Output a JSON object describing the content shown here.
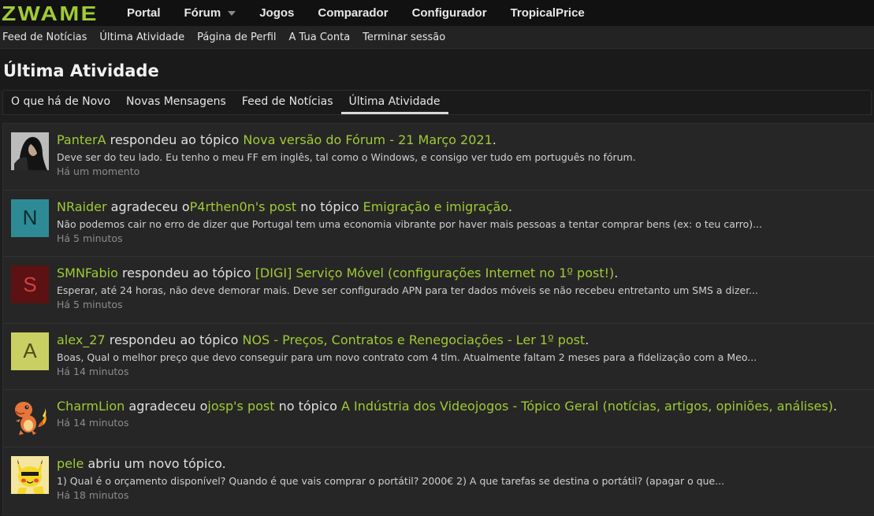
{
  "logo": "ZWAME",
  "topnav": [
    "Portal",
    "Fórum",
    "Jogos",
    "Comparador",
    "Configurador",
    "TropicalPrice"
  ],
  "subnav": [
    "Feed de Notícias",
    "Última Atividade",
    "Página de Perfil",
    "A Tua Conta",
    "Terminar sessão"
  ],
  "page_title": "Última Atividade",
  "tabs": [
    "O que há de Novo",
    "Novas Mensagens",
    "Feed de Notícias",
    "Última Atividade"
  ],
  "colors": {
    "accent": "#9fcb34",
    "background": "#1e1e1e",
    "panel": "#262626"
  },
  "items": [
    {
      "user": "PanterA",
      "verb": " respondeu ao tópico ",
      "thread": "Nova versão do Fórum - 21 Março 2021",
      "end": ".",
      "snippet": "Deve ser do teu lado. Eu tenho o meu FF em inglês, tal como o Windows, e consigo ver tudo em português no fórum.",
      "time": "Há um momento",
      "avatar": {
        "type": "photo",
        "letter": ""
      }
    },
    {
      "user": "NRaider",
      "verb": " agradeceu o",
      "post_owner": "P4rthen0n's post",
      "verb2": " no tópico ",
      "thread": "Emigração e imigração",
      "end": ".",
      "snippet": "Não podemos cair no erro de dizer que Portugal tem uma economia vibrante por haver mais pessoas a tentar comprar bens (ex: o teu carro)...",
      "time": "Há 5 minutos",
      "avatar": {
        "type": "letter",
        "letter": "N",
        "bg": "#2e8b96",
        "fg": "#0d2b2f"
      }
    },
    {
      "user": "SMNFabio",
      "verb": " respondeu ao tópico ",
      "thread": "[DIGI] Serviço Móvel (configurações Internet no 1º post!)",
      "end": ".",
      "snippet": "Esperar, até 24 horas, não deve demorar mais. Deve ser configurado APN para ter dados móveis se não recebeu entretanto um SMS a dizer...",
      "time": "Há 5 minutos",
      "avatar": {
        "type": "letter",
        "letter": "S",
        "bg": "#5c1212",
        "fg": "#d04040"
      }
    },
    {
      "user": "alex_27",
      "verb": " respondeu ao tópico ",
      "thread": "NOS - Preços, Contratos e Renegociações - Ler 1º post",
      "end": ".",
      "snippet": "Boas, Qual o melhor preço que devo conseguir para um novo contrato com 4 tlm. Atualmente faltam 2 meses para a fidelização com a Meo...",
      "time": "Há 14 minutos",
      "avatar": {
        "type": "letter",
        "letter": "A",
        "bg": "#c9cf62",
        "fg": "#4b4e1c"
      }
    },
    {
      "user": "CharmLion",
      "verb": " agradeceu o",
      "post_owner": "josp's post",
      "verb2": " no tópico ",
      "thread": "A Indústria dos Videojogos - Tópico Geral (notícias, artigos, opiniões, análises)",
      "end": ".",
      "snippet": "",
      "time": "Há 14 minutos",
      "avatar": {
        "type": "charmander",
        "letter": ""
      }
    },
    {
      "user": "pele",
      "verb": " abriu um novo tópico.",
      "thread": "",
      "end": "",
      "snippet": "1) Qual é o orçamento disponível? Quando é que vais comprar o portátil? 2000€ 2) A que tarefas se destina o portátil? (apagar o que...",
      "time": "Há 18 minutos",
      "avatar": {
        "type": "pikachu",
        "letter": ""
      }
    }
  ]
}
